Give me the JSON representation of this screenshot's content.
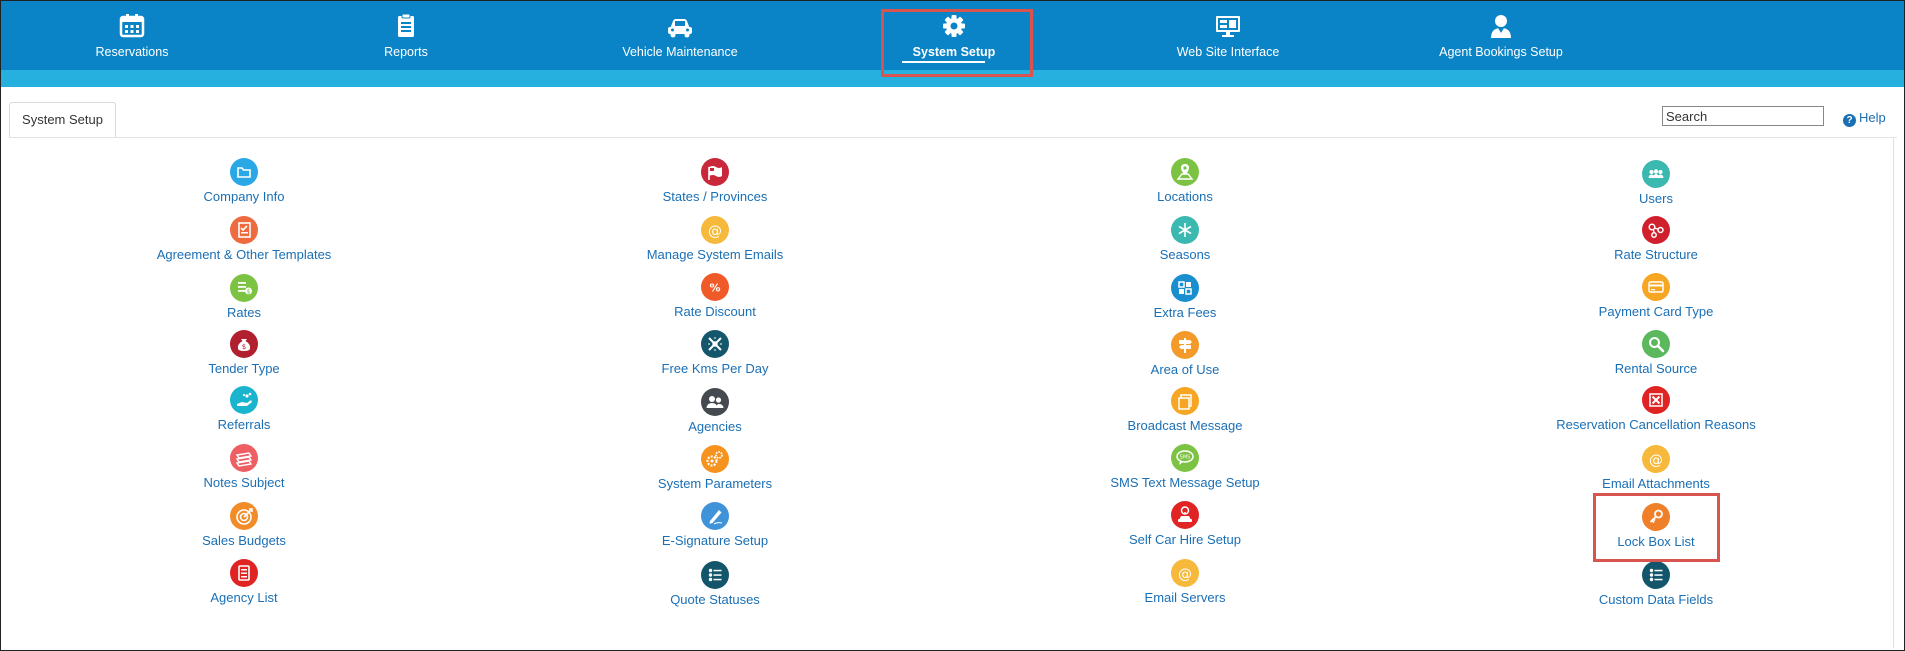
{
  "nav": {
    "items": [
      {
        "label": "Reservations"
      },
      {
        "label": "Reports"
      },
      {
        "label": "Vehicle Maintenance"
      },
      {
        "label": "System Setup"
      },
      {
        "label": "Web Site Interface"
      },
      {
        "label": "Agent Bookings Setup"
      }
    ],
    "active": "System Setup"
  },
  "tab": {
    "label": "System Setup"
  },
  "search": {
    "placeholder": "Search"
  },
  "help": {
    "label": "Help"
  },
  "colors": {
    "nav_bg": "#0a84c6",
    "nav_strip": "#25b0e0",
    "link": "#1a6fb5",
    "highlight": "#d9534f"
  },
  "grid": {
    "col1": [
      {
        "label": "Company Info",
        "icon": "folder-icon",
        "color": "#2aa8e6"
      },
      {
        "label": "Agreement & Other Templates",
        "icon": "checklist-icon",
        "color": "#ee6a3f"
      },
      {
        "label": "Rates",
        "icon": "dollar-list-icon",
        "color": "#7cc243"
      },
      {
        "label": "Tender Type",
        "icon": "money-bag-icon",
        "color": "#b0202e"
      },
      {
        "label": "Referrals",
        "icon": "hand-share-icon",
        "color": "#1bb4cf"
      },
      {
        "label": "Notes Subject",
        "icon": "notes-stack-icon",
        "color": "#ee5e63"
      },
      {
        "label": "Sales Budgets",
        "icon": "target-icon",
        "color": "#f28c28"
      },
      {
        "label": "Agency List",
        "icon": "document-list-icon",
        "color": "#e02424"
      }
    ],
    "col2": [
      {
        "label": "States / Provinces",
        "icon": "flag-icon",
        "color": "#c8283a"
      },
      {
        "label": "Manage System Emails",
        "icon": "at-sign-icon",
        "color": "#f6b93b"
      },
      {
        "label": "Rate Discount",
        "icon": "percent-icon",
        "color": "#f05a28"
      },
      {
        "label": "Free Kms Per Day",
        "icon": "road-icon",
        "color": "#14566b"
      },
      {
        "label": "Agencies",
        "icon": "group-icon",
        "color": "#444a50"
      },
      {
        "label": "System Parameters",
        "icon": "gears-icon",
        "color": "#f6921e"
      },
      {
        "label": "E-Signature Setup",
        "icon": "pen-icon",
        "color": "#3f93d8"
      },
      {
        "label": "Quote Statuses",
        "icon": "status-list-icon",
        "color": "#13566b"
      }
    ],
    "col3": [
      {
        "label": "Locations",
        "icon": "map-pin-icon",
        "color": "#7cc243"
      },
      {
        "label": "Seasons",
        "icon": "snowflake-icon",
        "color": "#3bb8b0"
      },
      {
        "label": "Extra Fees",
        "icon": "grid-icon",
        "color": "#1a8fd0"
      },
      {
        "label": "Area of Use",
        "icon": "signpost-icon",
        "color": "#f39a2b"
      },
      {
        "label": "Broadcast Message",
        "icon": "copy-icon",
        "color": "#f6a623"
      },
      {
        "label": "SMS Text Message Setup",
        "icon": "sms-bubble-icon",
        "color": "#7cc243"
      },
      {
        "label": "Self Car Hire Setup",
        "icon": "car-key-icon",
        "color": "#e02424"
      },
      {
        "label": "Email Servers",
        "icon": "at-sign-icon",
        "color": "#f6b93b"
      }
    ],
    "col4": [
      {
        "label": "Users",
        "icon": "users-icon",
        "color": "#3bb8b0"
      },
      {
        "label": "Rate Structure",
        "icon": "structure-icon",
        "color": "#d0202e"
      },
      {
        "label": "Payment Card Type",
        "icon": "credit-card-icon",
        "color": "#f6a623"
      },
      {
        "label": "Rental Source",
        "icon": "magnifier-icon",
        "color": "#5cb85c"
      },
      {
        "label": "Reservation Cancellation Reasons",
        "icon": "cancel-x-icon",
        "color": "#e02424"
      },
      {
        "label": "Email Attachments",
        "icon": "at-sign-icon",
        "color": "#f6b93b"
      },
      {
        "label": "Lock Box List",
        "icon": "key-icon",
        "color": "#f07f2a"
      },
      {
        "label": "Custom Data Fields",
        "icon": "status-list-icon",
        "color": "#13566b"
      }
    ]
  }
}
